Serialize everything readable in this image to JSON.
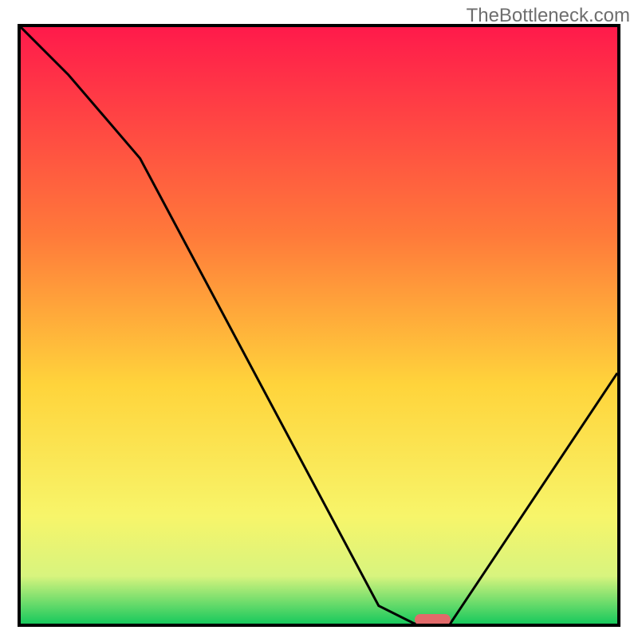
{
  "attribution": "TheBottleneck.com",
  "chart_data": {
    "type": "line",
    "title": "",
    "xlabel": "",
    "ylabel": "",
    "xlim": [
      0,
      100
    ],
    "ylim": [
      0,
      100
    ],
    "series": [
      {
        "name": "bottleneck-curve",
        "x": [
          0,
          8,
          20,
          60,
          66,
          72,
          100
        ],
        "values": [
          100,
          92,
          78,
          3,
          0,
          0,
          42
        ]
      }
    ],
    "optimal_marker": {
      "x_start": 66,
      "x_end": 72,
      "y": 0
    },
    "gradient_stops": [
      {
        "pct": 0,
        "color": "#ff1a4b"
      },
      {
        "pct": 35,
        "color": "#ff7a3a"
      },
      {
        "pct": 60,
        "color": "#ffd43b"
      },
      {
        "pct": 82,
        "color": "#f7f56a"
      },
      {
        "pct": 92,
        "color": "#d8f47e"
      },
      {
        "pct": 100,
        "color": "#18c95d"
      }
    ]
  }
}
